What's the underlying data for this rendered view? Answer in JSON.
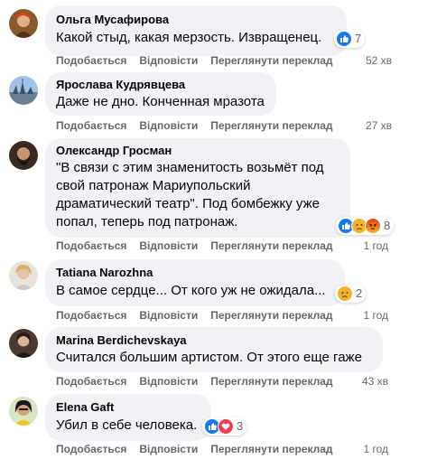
{
  "actions": {
    "like": "Подобається",
    "reply": "Відповісти",
    "translate": "Переглянути переклад"
  },
  "comments": [
    {
      "author": "Ольга Мусафирова",
      "text": "Какой стыд, какая мерзость. Извращенец.",
      "reactions": [
        "like"
      ],
      "reaction_count": "7",
      "time": "52 хв"
    },
    {
      "author": "Ярослава Кудрявцева",
      "text": "Даже не дно. Конченная мразота",
      "reactions": [],
      "reaction_count": "",
      "time": "27 хв"
    },
    {
      "author": "Олександр Гросман",
      "text_lines": [
        "\"В связи с этим знаменитость возьмёт под",
        "свой патронаж Мариупольский",
        "драматический театр\". Под бомбежку уже",
        "попал, теперь под патронаж."
      ],
      "reactions": [
        "like",
        "sad",
        "angry"
      ],
      "reaction_count": "8",
      "time": "1 год"
    },
    {
      "author": "Tatiana Narozhna",
      "text": "В самое сердце... От кого уж не ожидала...",
      "reactions": [
        "sad"
      ],
      "reaction_count": "2",
      "time": "1 год"
    },
    {
      "author": "Marina Berdichevskaya",
      "text": "Считался большим артистом. От этого еще гаже",
      "reactions": [],
      "reaction_count": "",
      "time": "43 хв"
    },
    {
      "author": "Elena Gaft",
      "text": "Убил в себе человека.",
      "reactions": [
        "like",
        "love"
      ],
      "reaction_count": "3",
      "time": "1 год"
    }
  ],
  "colors": {
    "bubble": "#f0f2f5",
    "like": "#1877f2",
    "love": "#f33e58",
    "sad": "#f7b125",
    "angry": "#e9710f",
    "meta": "#65676b"
  }
}
